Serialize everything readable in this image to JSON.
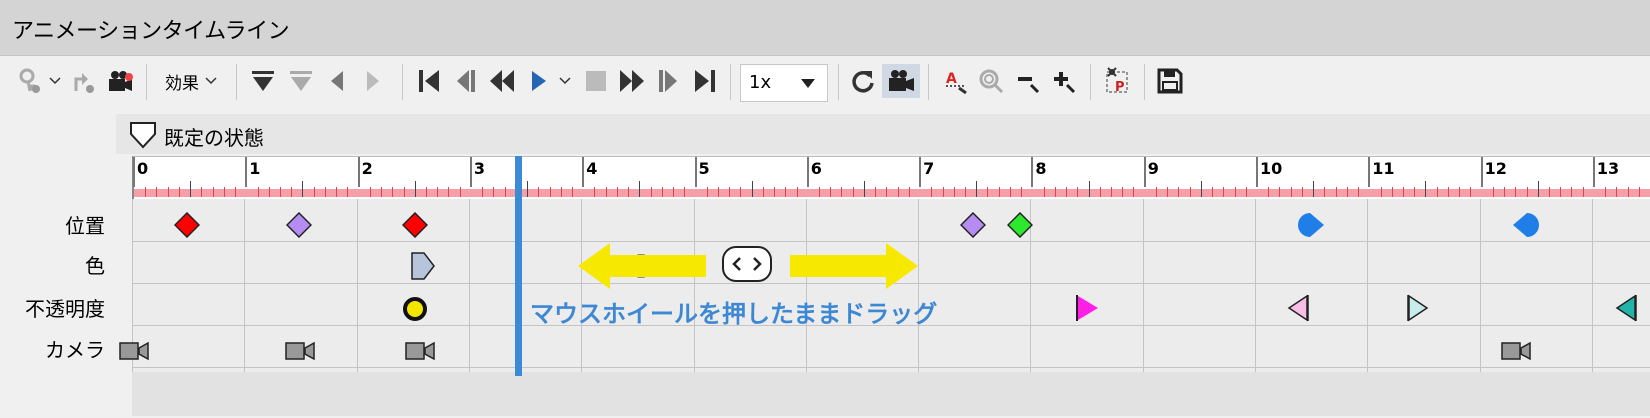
{
  "window": {
    "title": "アニメーションタイムライン"
  },
  "toolbar": {
    "effect_label": "効果",
    "speed_value": "1x",
    "icons": [
      "key-icon",
      "chevron-down-icon",
      "path-icon",
      "camera-key-icon",
      "interpolation-down-icon",
      "interpolation-up-icon",
      "prev-key-icon",
      "next-key-icon",
      "go-start-icon",
      "step-back-icon",
      "rewind-icon",
      "play-icon",
      "stop-icon",
      "fast-forward-icon",
      "step-forward-icon",
      "go-end-icon",
      "loop-icon",
      "camera-icon",
      "zoom-text-icon",
      "zoom-fit-icon",
      "zoom-out-icon",
      "zoom-in-icon",
      "pivot-icon",
      "save-icon"
    ]
  },
  "state": {
    "label": "既定の状態"
  },
  "ruler": {
    "labels": [
      "0",
      "1",
      "2",
      "3",
      "4",
      "5",
      "6",
      "7",
      "8",
      "9",
      "10",
      "11",
      "12",
      "13"
    ]
  },
  "tracks": [
    {
      "label": "位置"
    },
    {
      "label": "色"
    },
    {
      "label": "不透明度"
    },
    {
      "label": "カメラ"
    }
  ],
  "hint": {
    "text": "マウスホイールを押したままドラッグ"
  },
  "colors": {
    "playhead": "#3b8ad6",
    "hint": "#3d88d4",
    "arrow": "#f7e800",
    "ruler_band": "#f5a0a8"
  }
}
